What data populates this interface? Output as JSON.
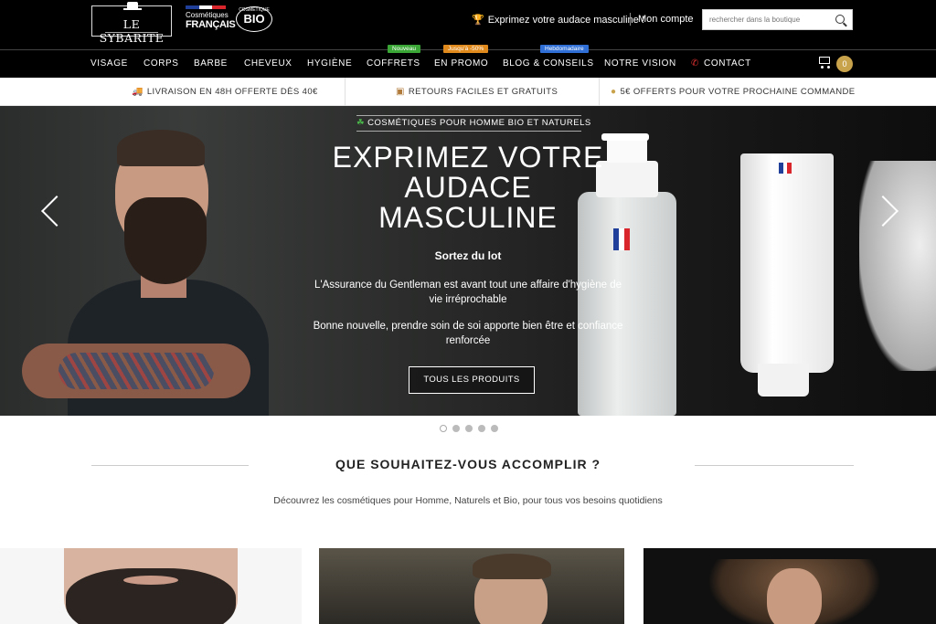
{
  "brand": {
    "logo_text": "LE SYBARITE",
    "cf_line1": "Cosmétiques",
    "cf_line2": "FRANÇAIS",
    "bio_small": "COSMÉTIQUE",
    "bio_label": "BIO"
  },
  "header": {
    "tagline": "Exprimez votre audace masculine !",
    "account": "Mon compte",
    "search_placeholder": "rechercher dans la boutique"
  },
  "nav": {
    "items": [
      {
        "label": "VISAGE"
      },
      {
        "label": "CORPS"
      },
      {
        "label": "BARBE"
      },
      {
        "label": "CHEVEUX"
      },
      {
        "label": "HYGIÈNE"
      },
      {
        "label": "COFFRETS",
        "badge": "Nouveau",
        "badge_color": "#3aa635"
      },
      {
        "label": "EN PROMO",
        "badge": "Jusqu'à -50%",
        "badge_color": "#e08a1e"
      },
      {
        "label": "BLOG & CONSEILS",
        "badge": "Hebdomadaire",
        "badge_color": "#2f6fd6"
      },
      {
        "label": "NOTRE VISION"
      },
      {
        "label": "CONTACT",
        "icon": "phone-icon"
      }
    ],
    "cart_count": "0"
  },
  "benefits": [
    {
      "icon": "truck-icon",
      "text": "LIVRAISON EN 48H OFFERTE DÈS 40€"
    },
    {
      "icon": "box-icon",
      "text": "RETOURS FACILES ET GRATUITS"
    },
    {
      "icon": "coin-icon",
      "text": "5€ OFFERTS POUR VOTRE PROCHAINE COMMANDE"
    }
  ],
  "hero": {
    "tag": "COSMÉTIQUES POUR HOMME BIO ET NATURELS",
    "title_line1": "EXPRIMEZ VOTRE",
    "title_line2": "AUDACE",
    "title_line3": "MASCULINE",
    "subtitle": "Sortez du lot",
    "paragraph1": "L'Assurance du Gentleman est avant tout une affaire d'hygiène de vie irréprochable",
    "paragraph2": "Bonne nouvelle, prendre soin de soi apporte bien être et confiance renforcée",
    "button": "TOUS LES PRODUITS",
    "slides_total": 5,
    "active_slide": 1
  },
  "section": {
    "title": "QUE SOUHAITEZ-VOUS ACCOMPLIR ?",
    "description": "Découvrez les cosmétiques pour Homme, Naturels et Bio, pour tous vos besoins quotidiens"
  },
  "colors": {
    "accent_gold": "#c9a24c",
    "flag_blue": "#1f3f9a",
    "flag_white": "#ffffff",
    "flag_red": "#d8262c"
  }
}
